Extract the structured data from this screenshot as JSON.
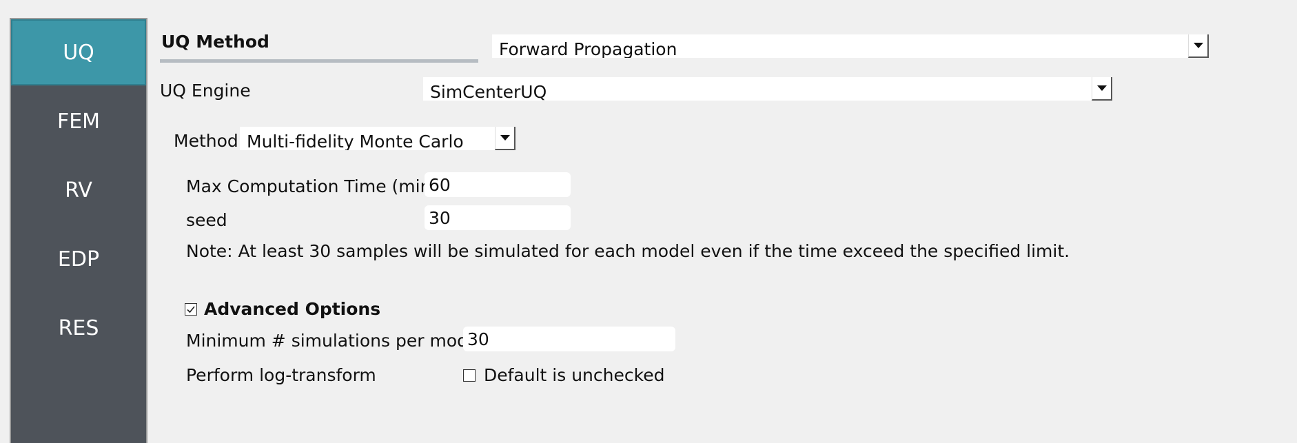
{
  "sidebar": {
    "items": [
      {
        "label": "UQ",
        "active": true
      },
      {
        "label": "FEM",
        "active": false
      },
      {
        "label": "RV",
        "active": false
      },
      {
        "label": "EDP",
        "active": false
      },
      {
        "label": "RES",
        "active": false
      }
    ]
  },
  "uq_method": {
    "title": "UQ Method",
    "selected": "Forward Propagation"
  },
  "uq_engine": {
    "label": "UQ Engine",
    "selected": "SimCenterUQ"
  },
  "method": {
    "label": "Method",
    "selected": "Multi-fidelity Monte Carlo"
  },
  "max_time": {
    "label": "Max Computation Time (min)",
    "value": "60"
  },
  "seed": {
    "label": "seed",
    "value": "30"
  },
  "note": "Note: At least 30 samples will be simulated for each model even if the time exceed the specified limit.",
  "advanced": {
    "label": "Advanced Options",
    "checked": true,
    "check_mark": "☑"
  },
  "min_sims": {
    "label": "Minimum # simulations per model",
    "value": "30"
  },
  "log_transform": {
    "label": "Perform log-transform",
    "checkbox_label": "Default is unchecked",
    "checked": false
  },
  "colors": {
    "sidebar_bg": "#4e535a",
    "sidebar_active": "#3d97a8",
    "background": "#f0f0f0"
  }
}
